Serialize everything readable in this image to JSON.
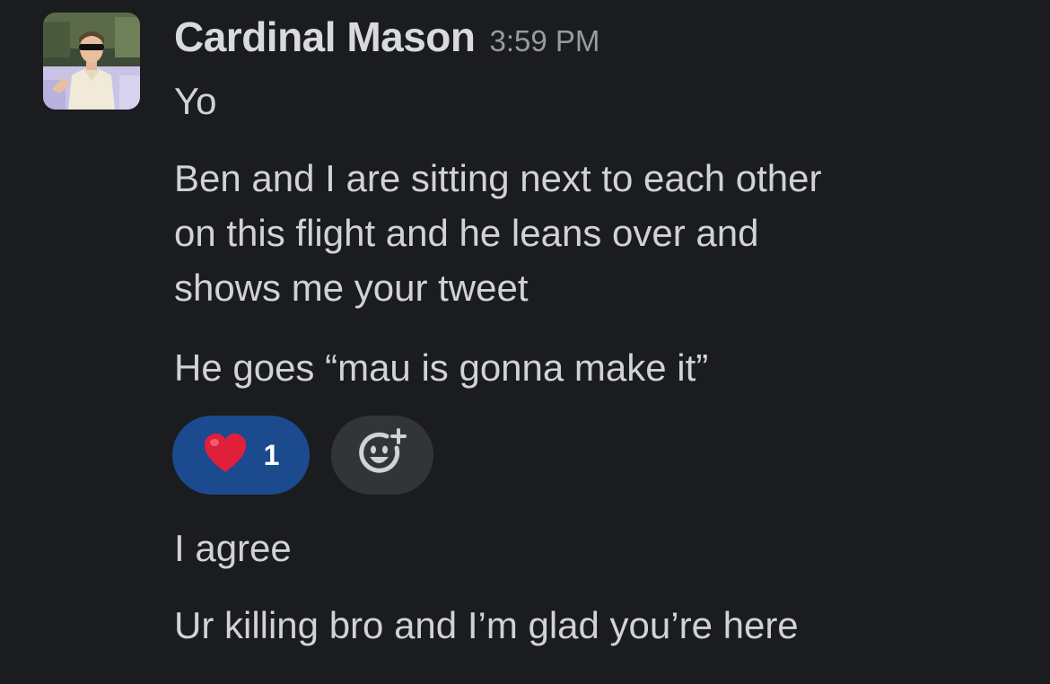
{
  "message": {
    "author": "Cardinal Mason",
    "timestamp": "3:59 PM",
    "avatar_icon": "profile-photo",
    "lines": [
      "Yo",
      "Ben and I are sitting next to each other",
      "on this flight and he leans over and",
      "shows me your tweet",
      "He goes “mau is gonna make it”",
      "I agree",
      "Ur killing bro and I’m glad you’re here"
    ]
  },
  "reactions": [
    {
      "emoji": "heart-emoji",
      "count": "1",
      "active": true,
      "color": "#1c4a8f"
    }
  ],
  "add_reaction": {
    "icon": "add-reaction-icon"
  },
  "colors": {
    "background": "#1b1c1f",
    "text": "#d1d2d3",
    "timestamp": "#9a9b9e",
    "reaction_active": "#1c4a8f",
    "reaction_add": "#323437",
    "heart": "#e0203a"
  }
}
